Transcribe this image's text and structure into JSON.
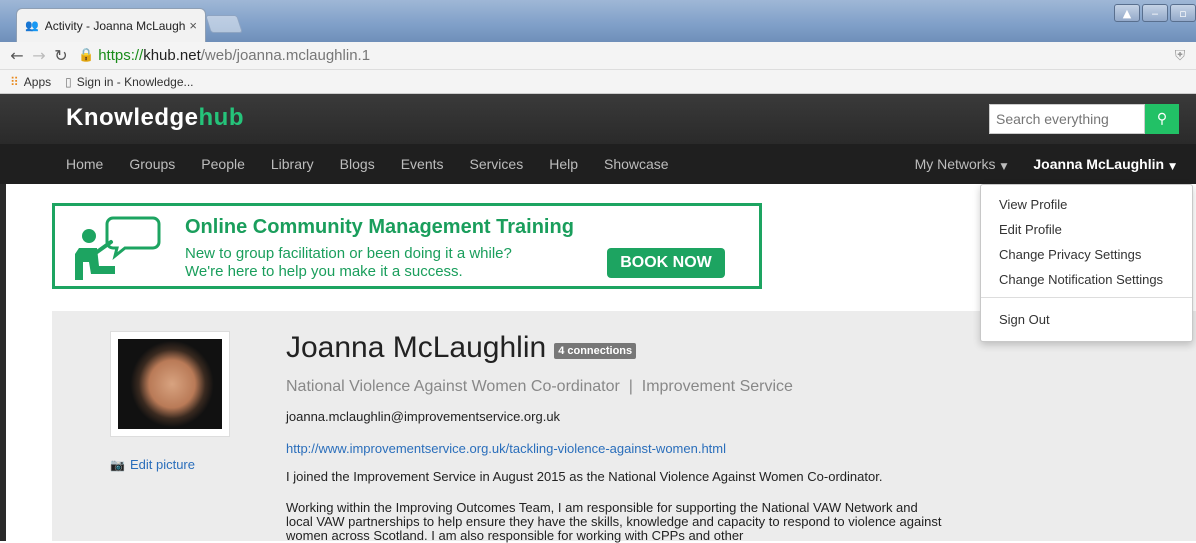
{
  "browser": {
    "tab_title": "Activity - Joanna McLaugh",
    "tab_close": "×",
    "url_scheme": "https://",
    "url_host": "khub.net",
    "url_path": "/web/joanna.mclaughlin.1",
    "bookmarks": {
      "apps": "Apps",
      "signin": "Sign in - Knowledge..."
    }
  },
  "site": {
    "logo_main": "Knowledge",
    "logo_accent": "hub",
    "search_placeholder": "Search everything",
    "nav": [
      "Home",
      "Groups",
      "People",
      "Library",
      "Blogs",
      "Events",
      "Services",
      "Help",
      "Showcase"
    ],
    "my_networks": "My Networks",
    "user_name": "Joanna McLaughlin"
  },
  "banner": {
    "title": "Online Community Management Training",
    "line1": "New to group facilitation or been doing it a while?",
    "line2": "We're here to help you make it a success.",
    "cta": "BOOK NOW"
  },
  "profile": {
    "name": "Joanna McLaughlin",
    "connections": "4 connections",
    "role": "National Violence Against Women Co-ordinator  |  Improvement Service",
    "email": "joanna.mclaughlin@improvementservice.org.uk",
    "link": "http://www.improvementservice.org.uk/tackling-violence-against-women.html",
    "bio1": "I joined the Improvement Service in August 2015 as the National Violence Against Women Co-ordinator.",
    "bio2": "Working within the Improving Outcomes Team, I am responsible for supporting the National VAW Network and local VAW partnerships to help ensure they have the skills, knowledge and capacity to respond to violence against women across Scotland. I am also responsible for working with CPPs and other",
    "edit_picture": "Edit picture"
  },
  "dropdown": {
    "items": [
      "View Profile",
      "Edit Profile",
      "Change Privacy Settings",
      "Change Notification Settings"
    ],
    "signout": "Sign Out"
  },
  "colors": {
    "brand_green": "#1da461",
    "nav_bg": "#1f1f1f",
    "link_blue": "#2a6ebb"
  }
}
